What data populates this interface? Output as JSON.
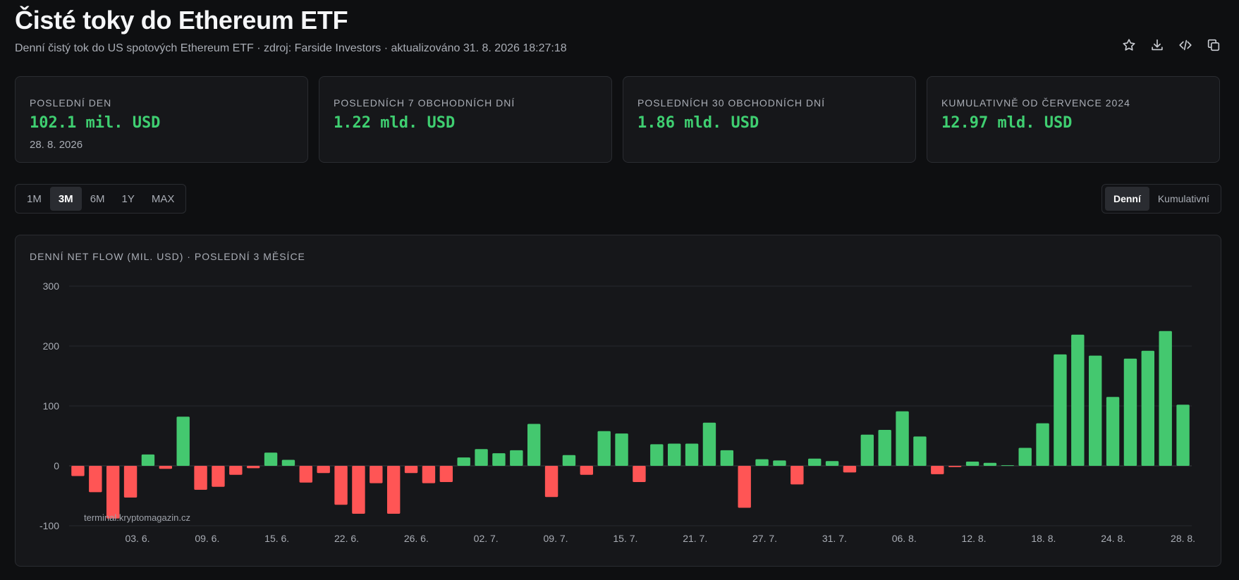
{
  "header": {
    "title": "Čisté toky do Ethereum ETF",
    "subtitle": "Denní čistý tok do US spotových Ethereum ETF · zdroj: Farside Investors · aktualizováno 31. 8. 2026 18:27:18"
  },
  "toolbar": {
    "icons": [
      "star-icon",
      "download-icon",
      "code-icon",
      "copy-icon"
    ]
  },
  "cards": [
    {
      "label": "POSLEDNÍ DEN",
      "value": "102.1 mil. USD",
      "sub": "28. 8. 2026"
    },
    {
      "label": "POSLEDNÍCH 7 OBCHODNÍCH DNÍ",
      "value": "1.22 mld. USD",
      "sub": ""
    },
    {
      "label": "POSLEDNÍCH 30 OBCHODNÍCH DNÍ",
      "value": "1.86 mld. USD",
      "sub": ""
    },
    {
      "label": "KUMULATIVNĚ OD ČERVENCE 2024",
      "value": "12.97 mld. USD",
      "sub": ""
    }
  ],
  "ranges": {
    "items": [
      "1M",
      "3M",
      "6M",
      "1Y",
      "MAX"
    ],
    "active": "3M"
  },
  "modes": {
    "items": [
      "Denní",
      "Kumulativní"
    ],
    "active": "Denní"
  },
  "chart": {
    "title": "DENNÍ NET FLOW (MIL. USD) · POSLEDNÍ 3 MĚSÍCE",
    "watermark": "terminal.kryptomagazin.cz"
  },
  "colors": {
    "positive": "#44c86f",
    "negative": "#ff5555",
    "accent": "#3fcf71"
  },
  "chart_data": {
    "type": "bar",
    "title": "DENNÍ NET FLOW (MIL. USD) · POSLEDNÍ 3 MĚSÍCE",
    "ylabel": "",
    "xlabel": "",
    "ylim": [
      -100,
      300
    ],
    "yticks": [
      -100,
      0,
      100,
      200,
      300
    ],
    "grid": true,
    "xtick_labels": [
      "03. 6.",
      "09. 6.",
      "15. 6.",
      "22. 6.",
      "26. 6.",
      "02. 7.",
      "09. 7.",
      "15. 7.",
      "21. 7.",
      "27. 7.",
      "31. 7.",
      "06. 8.",
      "12. 8.",
      "18. 8.",
      "24. 8.",
      "28. 8."
    ],
    "values": [
      -17,
      -44,
      -88,
      -53,
      19,
      -5,
      82,
      -40,
      -35,
      -15,
      -4,
      22,
      10,
      -28,
      -12,
      -65,
      -80,
      -29,
      -80,
      -12,
      -29,
      -27,
      14,
      28,
      21,
      26,
      70,
      -52,
      18,
      -15,
      58,
      54,
      -27,
      36,
      37,
      37,
      72,
      26,
      -70,
      11,
      9,
      -31,
      12,
      8,
      -11,
      52,
      60,
      91,
      49,
      -14,
      -2,
      7,
      5,
      1,
      30,
      71,
      186,
      219,
      184,
      115,
      179,
      192,
      225,
      102.1
    ]
  }
}
